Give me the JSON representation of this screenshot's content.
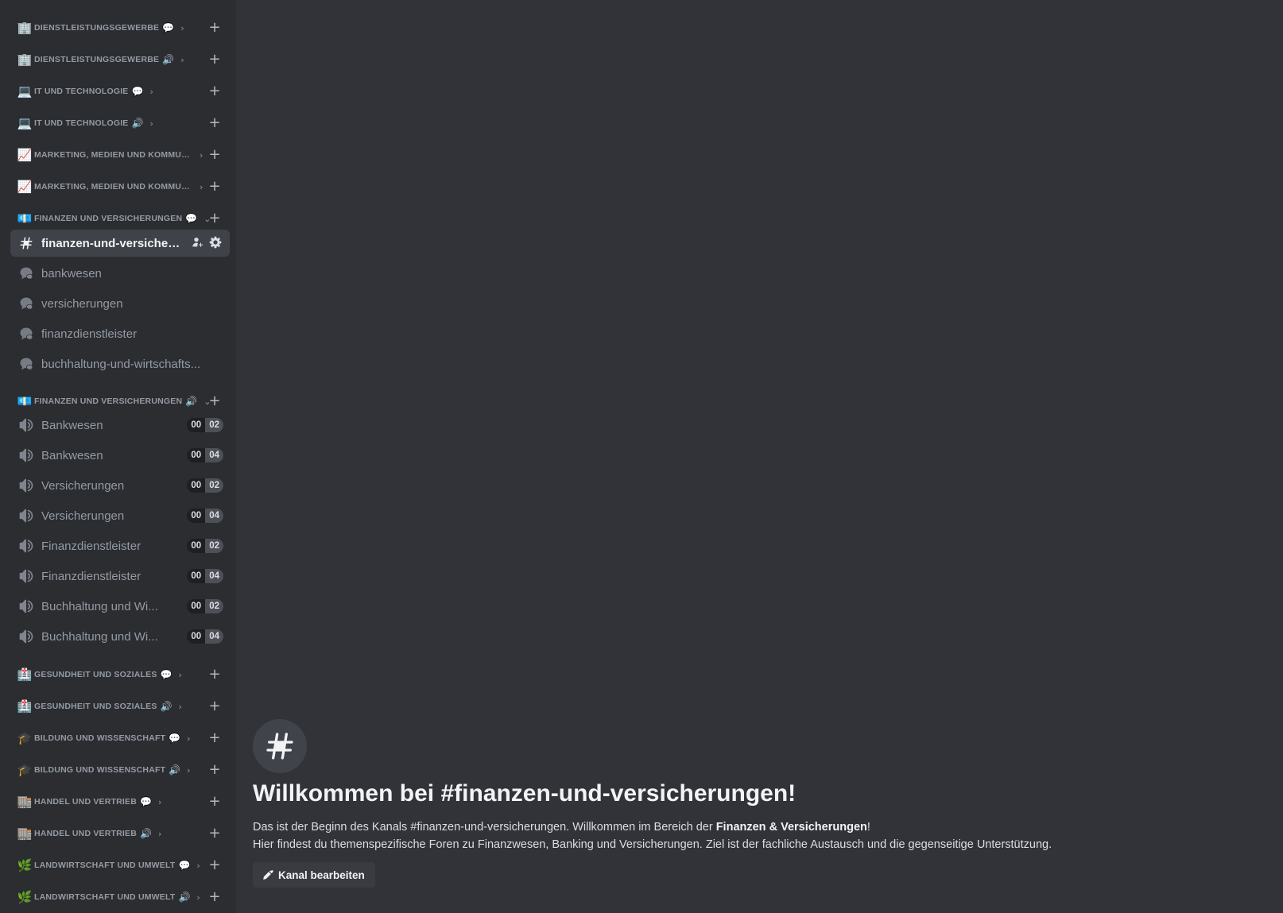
{
  "sidebar": {
    "categories_top": [
      {
        "emoji": "🏢",
        "name": "Dienstleistungsgewerbe",
        "kind": "💬"
      },
      {
        "emoji": "🏢",
        "name": "Dienstleistungsgewerbe",
        "kind": "🔊"
      },
      {
        "emoji": "💻",
        "name": "IT und Technologie",
        "kind": "💬"
      },
      {
        "emoji": "💻",
        "name": "IT und Technologie",
        "kind": "🔊"
      },
      {
        "emoji": "📈",
        "name": "Marketing, Medien und Kommuni...",
        "kind": ""
      },
      {
        "emoji": "📈",
        "name": "Marketing, Medien und Kommuni...",
        "kind": ""
      },
      {
        "emoji": "💶",
        "name": "Finanzen und Versicherungen",
        "kind": "💬"
      }
    ],
    "text_channels": [
      {
        "name": "finanzen-und-versicher..."
      },
      {
        "name": "bankwesen"
      },
      {
        "name": "versicherungen"
      },
      {
        "name": "finanzdienstleister"
      },
      {
        "name": "buchhaltung-und-wirtschafts..."
      }
    ],
    "voice_category": {
      "emoji": "💶",
      "name": "Finanzen und Versicherungen",
      "kind": "🔊"
    },
    "voice_channels": [
      {
        "name": "Bankwesen",
        "count": "00",
        "limit": "02"
      },
      {
        "name": "Bankwesen",
        "count": "00",
        "limit": "04"
      },
      {
        "name": "Versicherungen",
        "count": "00",
        "limit": "02"
      },
      {
        "name": "Versicherungen",
        "count": "00",
        "limit": "04"
      },
      {
        "name": "Finanzdienstleister",
        "count": "00",
        "limit": "02"
      },
      {
        "name": "Finanzdienstleister",
        "count": "00",
        "limit": "04"
      },
      {
        "name": "Buchhaltung und Wi...",
        "count": "00",
        "limit": "02"
      },
      {
        "name": "Buchhaltung und Wi...",
        "count": "00",
        "limit": "04"
      }
    ],
    "categories_bottom": [
      {
        "emoji": "🏥",
        "name": "Gesundheit und Soziales",
        "kind": "💬"
      },
      {
        "emoji": "🏥",
        "name": "Gesundheit und Soziales",
        "kind": "🔊"
      },
      {
        "emoji": "🎓",
        "name": "Bildung und Wissenschaft",
        "kind": "💬"
      },
      {
        "emoji": "🎓",
        "name": "Bildung und Wissenschaft",
        "kind": "🔊"
      },
      {
        "emoji": "🏬",
        "name": "Handel und Vertrieb",
        "kind": "💬"
      },
      {
        "emoji": "🏬",
        "name": "Handel und Vertrieb",
        "kind": "🔊"
      },
      {
        "emoji": "🌿",
        "name": "Landwirtschaft und Umwelt",
        "kind": "💬"
      },
      {
        "emoji": "🌿",
        "name": "Landwirtschaft und Umwelt",
        "kind": "🔊"
      }
    ]
  },
  "main": {
    "welcome_title": "Willkommen bei #finanzen-und-versicherungen!",
    "line1_prefix": "Das ist der Beginn des Kanals #finanzen-und-versicherungen. Willkommen im Bereich der ",
    "line1_bold": "Finanzen & Versicherungen",
    "line1_suffix": "!",
    "line2": "Hier findest du themenspezifische Foren zu Finanzwesen, Banking und Versicherungen. Ziel ist der fachliche Austausch und die gegenseitige Unterstützung.",
    "edit_button": "Kanal bearbeiten"
  }
}
